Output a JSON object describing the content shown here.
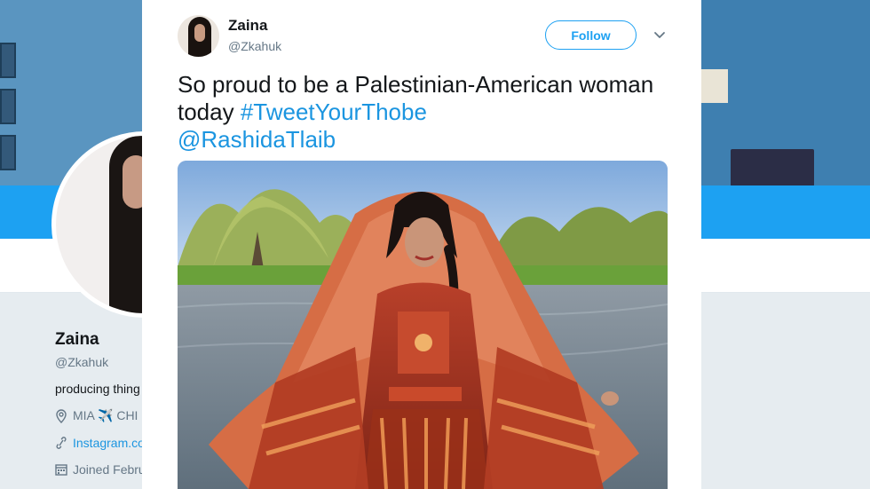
{
  "background_profile": {
    "name": "Zaina",
    "handle": "@Zkahuk",
    "bio": "producing thing",
    "location": "MIA ✈️ CHI",
    "link": "Instagram.co",
    "joined": "Joined Febru"
  },
  "tweet": {
    "author_name": "Zaina",
    "author_handle": "@Zkahuk",
    "follow_label": "Follow",
    "text_plain": "So proud to be a Palestinian-American woman today ",
    "hashtag": "#TweetYourThobe",
    "mention": "@RashidaTlaib"
  },
  "icons": {
    "more": "chevron-down-icon",
    "location": "location-pin-icon",
    "link": "link-icon",
    "calendar": "calendar-icon"
  },
  "colors": {
    "accent": "#1da1f2",
    "link": "#1b95e0",
    "text": "#14171a",
    "muted": "#657786"
  }
}
